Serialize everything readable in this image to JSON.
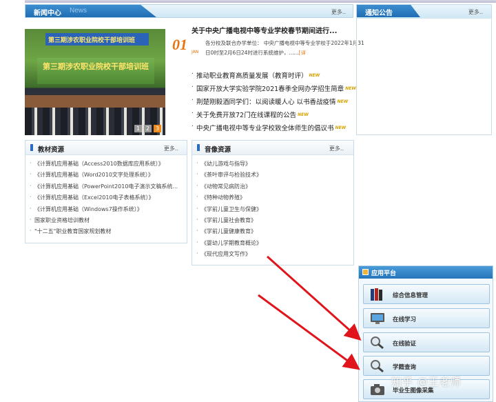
{
  "news": {
    "title_cn": "新闻中心",
    "title_en": "News",
    "more": "更多..",
    "photo": {
      "banner_top": "第三期涉农职业院校干部培训班",
      "banner_main": "第三期涉农职业院校干部培训班",
      "pages": [
        "1",
        "2",
        "3"
      ]
    },
    "headline": "关于中央广播电视中等专业学校春节期间进行...",
    "date_day": "01",
    "date_month": "JAN",
    "summary": "各分校及联合办学单位： 中央广播电视中等专业学校于2022年1月31日0时至2月6日24时进行系统维护，......",
    "summary_detail": "[详",
    "items": [
      "推动职业教育高质量发展（教育时评）",
      "国家开放大学实验学院2021春季全网办学招生简章",
      "荆楚刚毅酒同学们：以阅读暖人心 以书香战疫情",
      "关于免费开放72门在线课程的公告",
      "中央广播电视中等专业学校致全体师生的倡议书"
    ],
    "new_label": "NEW"
  },
  "notice": {
    "title": "通知公告",
    "more": "更多.."
  },
  "textbooks": {
    "title": "教材资源",
    "more": "更多..",
    "items": [
      "《计算机应用基础（Access2010数据库应用系统）》",
      "《计算机应用基础（Word2010文字处理系统）》",
      "《计算机应用基础（PowerPoint2010电子演示文稿系统...",
      "《计算机应用基础（Excel2010电子表格系统）》",
      "《计算机应用基础（Windows7操作系统）》",
      "国家职业资格培训教材",
      "\"十二五\"职业教育国家规划教材"
    ]
  },
  "audio_video": {
    "title": "音像资源",
    "more": "更多..",
    "items": [
      "《幼儿游戏与指导》",
      "《茶叶审评与检验技术》",
      "《动物常见病防治》",
      "《特种动物养殖》",
      "《学前儿童卫生与保健》",
      "《学前儿童社会教育》",
      "《学前儿童健康教育》",
      "《婴幼儿学期教育概论》",
      "《现代应用文写作》"
    ]
  },
  "app_platform": {
    "title": "应用平台",
    "buttons": [
      {
        "label": "综合信息管理",
        "icon": "books-icon"
      },
      {
        "label": "在线学习",
        "icon": "monitor-icon"
      },
      {
        "label": "在线验证",
        "icon": "magnifier-icon"
      },
      {
        "label": "学籍查询",
        "icon": "magnifier-icon"
      },
      {
        "label": "毕业生图像采集",
        "icon": "camera-icon"
      }
    ]
  },
  "watermark": "知乎 @王老师",
  "colors": {
    "tab_blue": "#2a7cc4",
    "accent_orange": "#e8730f",
    "arrow_red": "#e0141b"
  }
}
